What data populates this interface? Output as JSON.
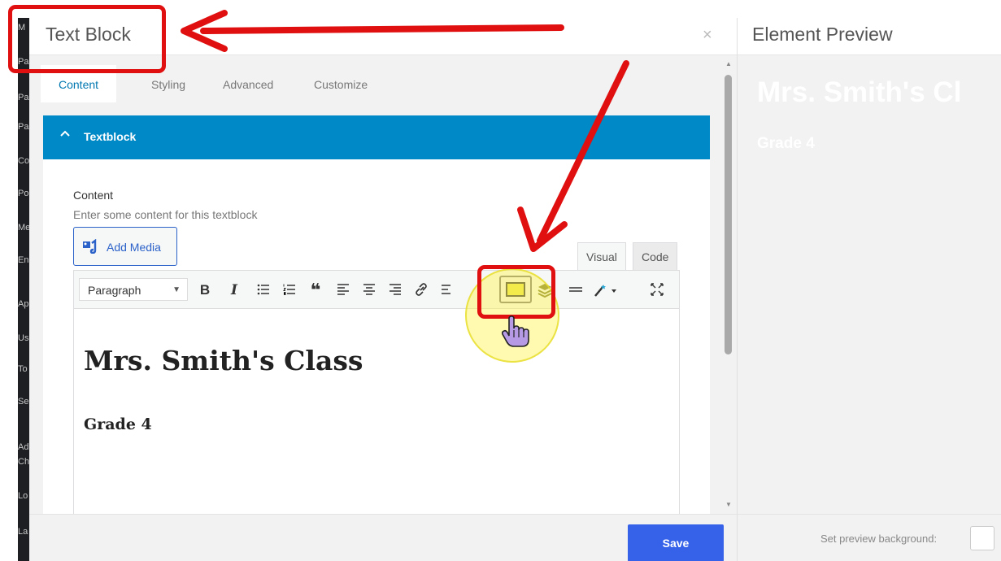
{
  "modal": {
    "title": "Text Block",
    "close_icon": "×",
    "tabs": [
      {
        "label": "Content",
        "active": true
      },
      {
        "label": "Styling",
        "active": false
      },
      {
        "label": "Advanced",
        "active": false
      },
      {
        "label": "Customize",
        "active": false
      }
    ],
    "section": {
      "header_label": "Textblock",
      "expanded": true
    },
    "field": {
      "label": "Content",
      "description": "Enter some content for this textblock"
    },
    "add_media_label": "Add Media",
    "editor_modes": {
      "visual": "Visual",
      "code": "Code"
    },
    "toolbar": {
      "format_value": "Paragraph",
      "buttons": [
        "bold",
        "italic",
        "bulleted-list",
        "numbered-list",
        "blockquote",
        "align-left",
        "align-center",
        "align-right",
        "link",
        "more",
        "toolbar-toggle",
        "layers",
        "horizontal-line",
        "magic-wand",
        "fullscreen"
      ],
      "bold_glyph": "B",
      "italic_glyph": "I",
      "quote_glyph": "❝"
    },
    "editor_content": {
      "heading": "Mrs. Smith's Class",
      "subheading": "Grade 4"
    },
    "save_label": "Save"
  },
  "preview": {
    "title": "Element Preview",
    "heading": "Mrs. Smith's Cl",
    "subheading": "Grade 4",
    "background_label": "Set preview background:"
  },
  "sidebar_fragments": [
    "M",
    "Pa",
    "Pag",
    "Pa",
    "Co",
    "Po",
    "Me",
    "En",
    "Ap",
    "Us",
    "To",
    "Se",
    "Ad",
    "Ch",
    "Lo",
    "La"
  ],
  "colors": {
    "accent_blue": "#0089c7",
    "save_blue": "#3662ea",
    "annotation_red": "#e01010",
    "highlight_yellow": "#fff550"
  }
}
